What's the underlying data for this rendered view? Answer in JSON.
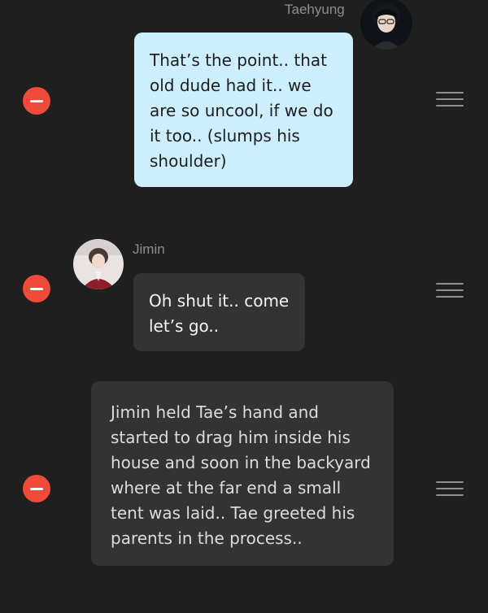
{
  "messages": [
    {
      "sender": "Taehyung",
      "text": "That’s the point.. that old dude had it.. we are so uncool, if we do it too.. (slumps his shoulder)",
      "side": "right"
    },
    {
      "sender": "Jimin",
      "text": "Oh shut it.. come let’s go..",
      "side": "left"
    },
    {
      "sender": "",
      "text": "Jimin held Tae’s hand and started to drag him inside his house and soon in the backyard where at the far end a small tent was laid.. Tae greeted his parents in the process..",
      "side": "narration"
    }
  ],
  "icons": {
    "delete": "minus-circle-icon",
    "reorder": "drag-handle-icon"
  },
  "colors": {
    "background": "#1f1f1f",
    "my_bubble": "#cdeefc",
    "other_bubble": "#333333",
    "delete_red": "#f04b3a"
  }
}
